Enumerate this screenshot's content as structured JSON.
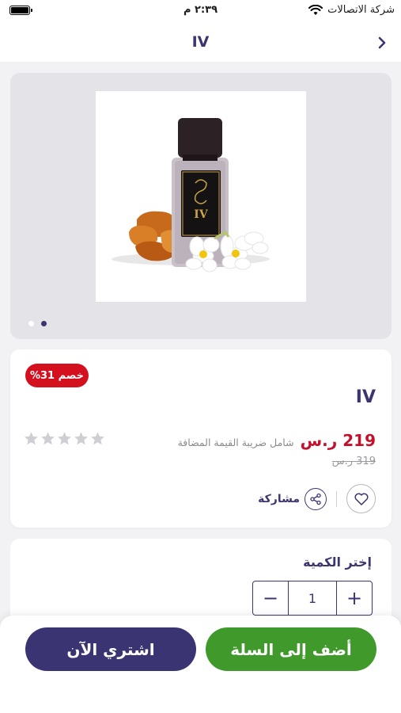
{
  "status_bar": {
    "time": "٢:٣٩ م",
    "carrier": "شركة الاتصالات",
    "battery_level": 1.0
  },
  "header": {
    "title": "IV",
    "back_icon": "chevron-right-icon"
  },
  "gallery": {
    "image_count": 2,
    "active_index": 1
  },
  "product": {
    "discount_badge": "خصم 31%",
    "name": "IV",
    "price": "219 ر.س",
    "vat_note": "شامل ضريبة القيمة المضافة",
    "old_price": "319 ر.س",
    "rating": 0,
    "rating_max": 5,
    "share_label": "مشاركة",
    "favorite_icon": "heart-icon",
    "share_icon": "share-icon"
  },
  "quantity": {
    "title": "إختر الكمية",
    "value": "1",
    "minus": "−",
    "plus": "+"
  },
  "actions": {
    "buy_now": "اشتري الآن",
    "add_to_cart": "أضف إلى السلة"
  },
  "colors": {
    "brand": "#3b3670",
    "price": "#c4102a",
    "badge": "#d4101f",
    "cart_button": "#3f9a2b",
    "buy_button": "#3a3472"
  }
}
